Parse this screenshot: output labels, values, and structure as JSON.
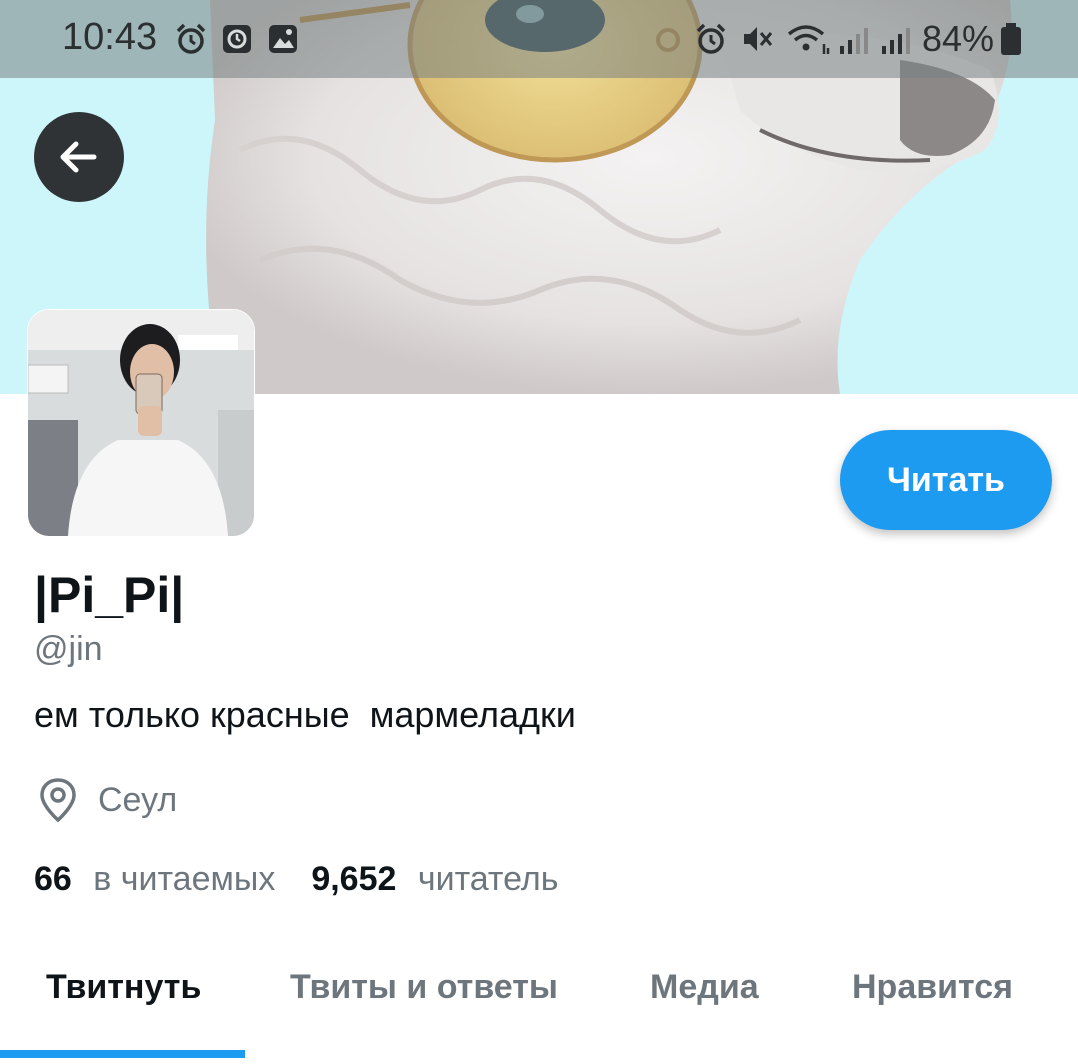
{
  "status_bar": {
    "time": "10:43",
    "battery": "84%",
    "left_icons": [
      "alarm-icon",
      "clock-app-icon",
      "gallery-icon"
    ],
    "right_icons": [
      "alarm-icon",
      "mute-icon",
      "wifi-icon",
      "signal-icon",
      "signal-icon",
      "battery-icon"
    ]
  },
  "header": {
    "back_icon": "arrow-left-icon"
  },
  "profile": {
    "display_name": "|Pi_Pi|",
    "handle": "@jin",
    "bio": "ем только красные  мармеладки",
    "location": "Сеул",
    "location_icon": "location-pin-icon",
    "following_count": "66",
    "following_label": "в читаемых",
    "followers_count": "9,652",
    "followers_label": "читатель",
    "follow_button": "Читать"
  },
  "tabs": [
    {
      "label": "Твитнуть",
      "active": true
    },
    {
      "label": "Твиты и ответы",
      "active": false
    },
    {
      "label": "Медиа",
      "active": false
    },
    {
      "label": "Нравится",
      "active": false
    }
  ],
  "colors": {
    "accent": "#1d9bf0",
    "banner_bg": "#cdf6fb",
    "text_primary": "#0f1419",
    "text_secondary": "#6e767d"
  }
}
